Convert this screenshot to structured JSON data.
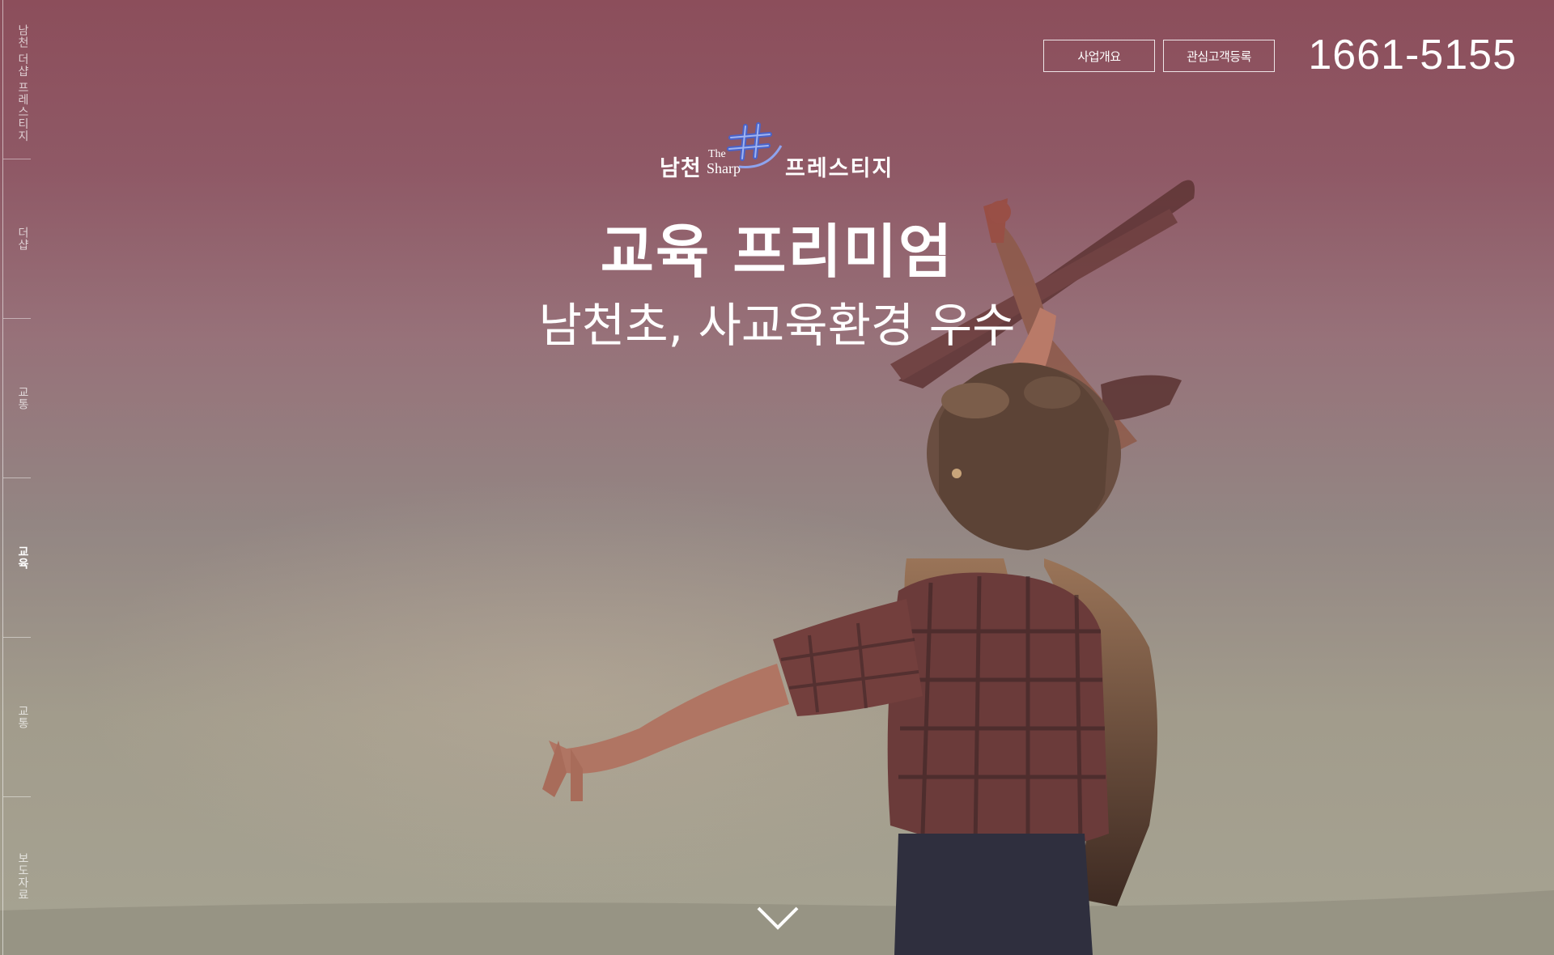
{
  "sidenav": {
    "items": [
      {
        "label": "남천 더샵 프레스티지",
        "active": false
      },
      {
        "label": "더샵",
        "active": false
      },
      {
        "label": "교통",
        "active": false
      },
      {
        "label": "교육",
        "active": true
      },
      {
        "label": "교통",
        "active": false
      },
      {
        "label": "보도자료",
        "active": false
      }
    ]
  },
  "header": {
    "overview_button": "사업개요",
    "register_button": "관심고객등록",
    "phone": "1661-5155"
  },
  "logo": {
    "left_text": "남천",
    "the_text": "The",
    "sharp_text": "Sharp",
    "right_text": "프레스티지"
  },
  "hero": {
    "title": "교육 프리미엄",
    "subtitle": "남천초, 사교육환경 우수"
  },
  "icons": {
    "scroll_down": "chevron-down-icon",
    "logo_mark": "sharp-hash-logo-icon"
  },
  "colors": {
    "top": "#8c4e5b",
    "bottom": "#a6a392",
    "text": "#ffffff"
  }
}
